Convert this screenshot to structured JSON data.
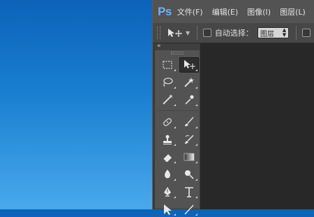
{
  "app": {
    "logo": "Ps",
    "menus": [
      "文件(F)",
      "编辑(E)",
      "图像(I)",
      "图层(L)"
    ]
  },
  "options_bar": {
    "auto_select_label": "自动选择：",
    "auto_select_value": "图层",
    "auto_select_checked": false,
    "second_checkbox_checked": false
  },
  "toolbox": {
    "tools": [
      "rectangular-marquee-tool",
      "move-tool",
      "lasso-tool",
      "magic-wand-tool",
      "crop-tool",
      "eyedropper-tool",
      "spot-healing-brush-tool",
      "brush-tool",
      "clone-stamp-tool",
      "history-brush-tool",
      "eraser-tool",
      "gradient-tool",
      "blur-tool",
      "dodge-tool",
      "pen-tool",
      "type-tool",
      "path-selection-tool",
      "line-tool"
    ],
    "active_tool": "move-tool"
  },
  "colors": {
    "desktop_top": "#0b63b8",
    "desktop_bottom": "#49a9ec",
    "menubar": "#535353",
    "canvas": "#282828",
    "logo": "#6ab0ff"
  }
}
